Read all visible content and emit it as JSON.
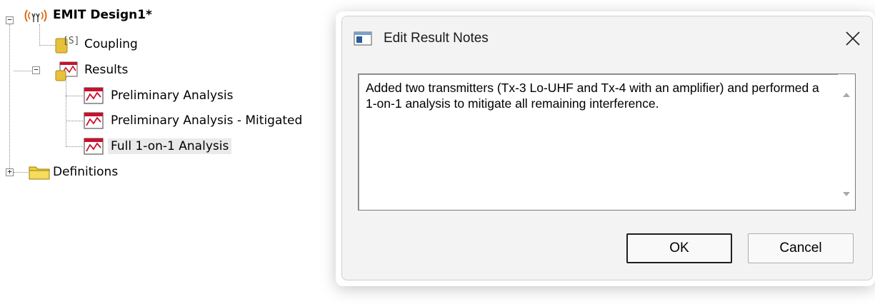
{
  "tree": {
    "root": {
      "label": "EMIT Design1*",
      "expander": "−",
      "icon": "emit-antenna-icon"
    },
    "coupling": {
      "label": "Coupling",
      "icon": "coupling-s-parameter-icon"
    },
    "results": {
      "label": "Results",
      "expander": "−",
      "icon": "results-folder-icon",
      "items": [
        {
          "label": "Preliminary Analysis",
          "icon": "result-chart-icon"
        },
        {
          "label": "Preliminary Analysis - Mitigated",
          "icon": "result-chart-icon"
        },
        {
          "label": "Full 1-on-1 Analysis",
          "icon": "result-chart-icon",
          "selected": true
        }
      ]
    },
    "definitions": {
      "label": "Definitions",
      "expander": "+",
      "icon": "folder-icon"
    }
  },
  "dialog": {
    "title": "Edit Result Notes",
    "icon": "window-app-icon",
    "close_glyph": "✕",
    "notes_text": "Added two transmitters (Tx-3 Lo-UHF and Tx-4 with an amplifier) and performed a 1-on-1 analysis to mitigate all remaining interference.",
    "ok_label": "OK",
    "cancel_label": "Cancel"
  },
  "colors": {
    "dialog_bg": "#f3f3f3",
    "icon_red": "#c8102e",
    "folder_yellow": "#f2cf3a"
  }
}
